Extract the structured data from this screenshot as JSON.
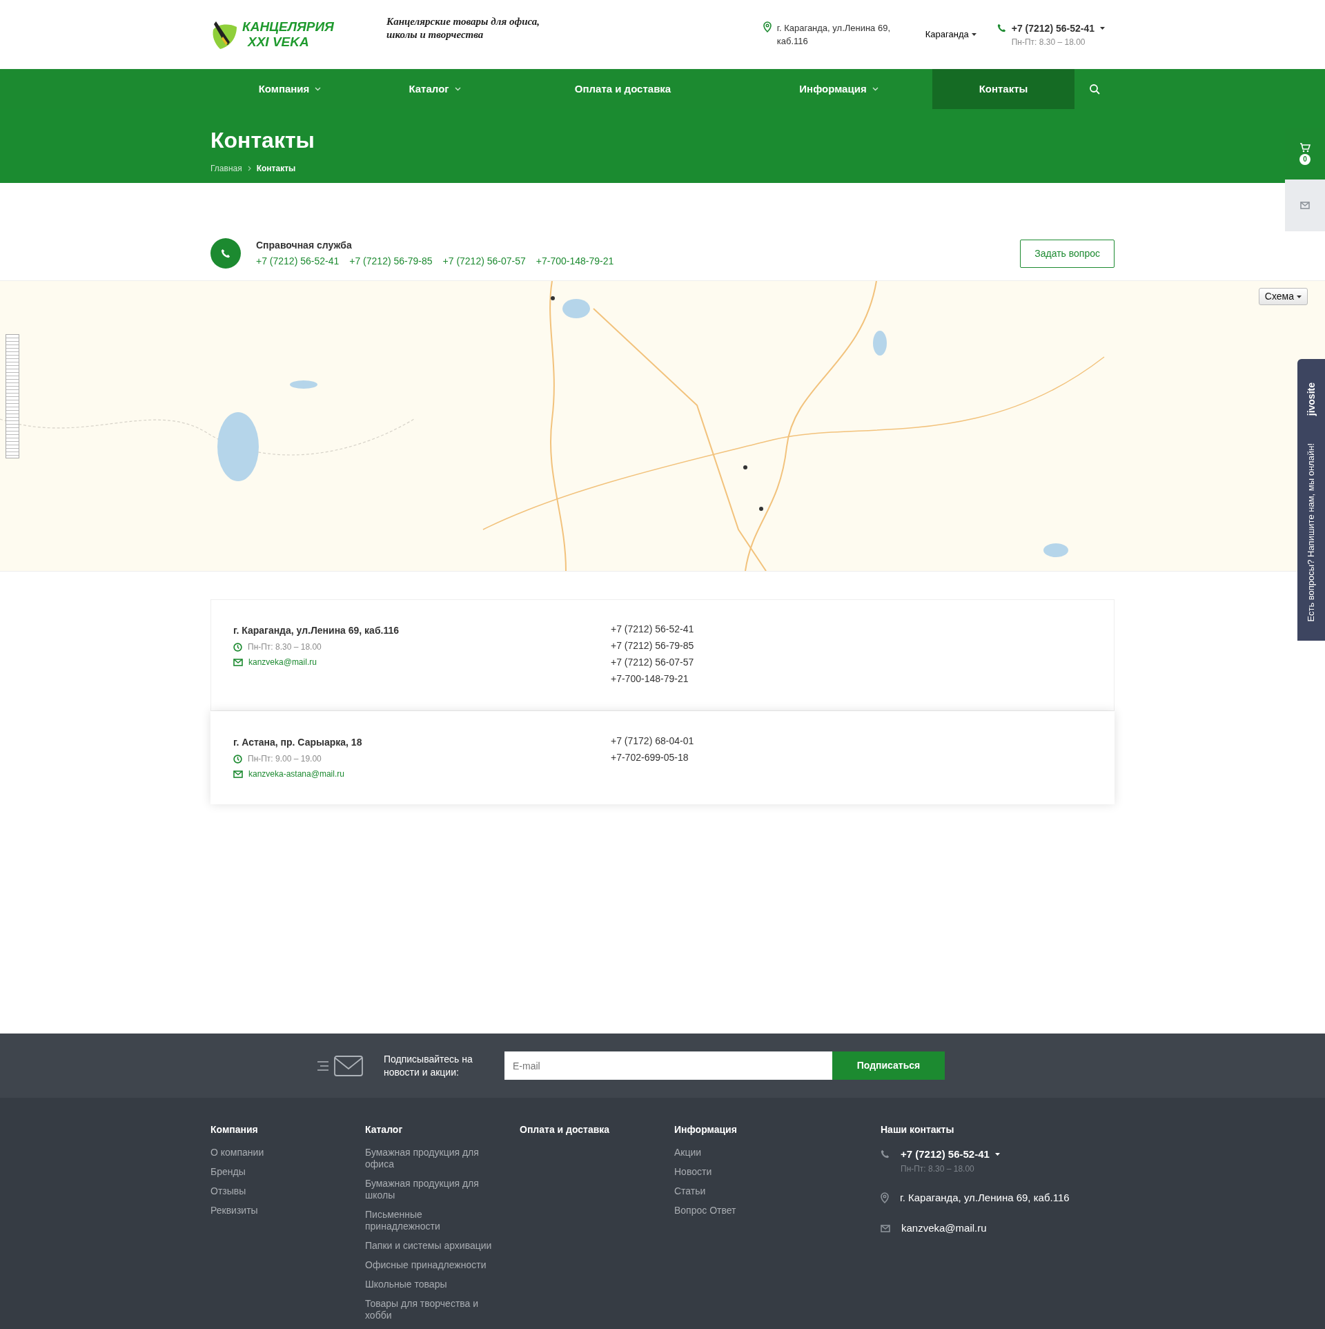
{
  "header": {
    "logo": {
      "line1": "КАНЦЕЛЯРИЯ",
      "line2": "XXI VEKA"
    },
    "tagline": "Канцелярские товары для офиса, школы и творчества",
    "address": "г. Караганда, ул.Ленина 69, каб.116",
    "city": "Караганда",
    "phone": "+7 (7212) 56-52-41",
    "hours": "Пн-Пт: 8.30 – 18.00"
  },
  "nav": {
    "items": [
      {
        "label": "Компания",
        "dropdown": true,
        "selected": false
      },
      {
        "label": "Каталог",
        "dropdown": true,
        "selected": false
      },
      {
        "label": "Оплата и доставка",
        "dropdown": false,
        "selected": false
      },
      {
        "label": "Информация",
        "dropdown": true,
        "selected": false
      },
      {
        "label": "Контакты",
        "dropdown": false,
        "selected": true
      }
    ]
  },
  "page_title": "Контакты",
  "breadcrumbs": [
    {
      "label": "Главная",
      "current": false
    },
    {
      "label": "Контакты",
      "current": true
    }
  ],
  "help": {
    "title": "Справочная служба",
    "phones": [
      "+7 (7212) 56-52-41",
      "+7 (7212) 56-79-85",
      "+7 (7212) 56-07-57",
      "+7-700-148-79-21"
    ],
    "button": "Задать вопрос"
  },
  "map": {
    "type_button": "Схема"
  },
  "offices": [
    {
      "address": "г. Караганда, ул.Ленина 69, каб.116",
      "hours": "Пн-Пт: 8.30 – 18.00",
      "email": "kanzveka@mail.ru",
      "phones": [
        "+7 (7212) 56-52-41",
        "+7 (7212) 56-79-85",
        "+7 (7212) 56-07-57",
        "+7-700-148-79-21"
      ],
      "highlighted": false
    },
    {
      "address": "г. Астана, пр. Сарыарка, 18",
      "hours": "Пн-Пт: 9.00 – 19.00",
      "email": "kanzveka-astana@mail.ru",
      "phones": [
        "+7 (7172) 68-04-01",
        "+7-702-699-05-18"
      ],
      "highlighted": true
    }
  ],
  "subscribe": {
    "text": "Подписывайтесь на новости и акции:",
    "placeholder": "E-mail",
    "button": "Подписаться"
  },
  "footer": {
    "columns": [
      {
        "title": "Компания",
        "links": [
          "О компании",
          "Бренды",
          "Отзывы",
          "Реквизиты"
        ]
      },
      {
        "title": "Каталог",
        "links": [
          "Бумажная продукция для офиса",
          "Бумажная продукция для школы",
          "Письменные принадлежности",
          "Папки и системы архивации",
          "Офисные принадлежности",
          "Школьные товары",
          "Товары для творчества и хобби"
        ]
      },
      {
        "title": "Оплата и доставка"
      },
      {
        "title": "Информация",
        "links": [
          "Акции",
          "Новости",
          "Статьи",
          "Вопрос Ответ"
        ]
      }
    ],
    "contacts": {
      "title": "Наши контакты",
      "phone": "+7 (7212) 56-52-41",
      "hours": "Пн-Пт: 8.30 – 18.00",
      "address": "г. Караганда, ул.Ленина 69, каб.116",
      "email": "kanzveka@mail.ru"
    }
  },
  "side": {
    "cart_count": "0",
    "chat_brand": "jivosite",
    "chat_text": "Есть вопросы? Напишите нам, мы онлайн!"
  }
}
